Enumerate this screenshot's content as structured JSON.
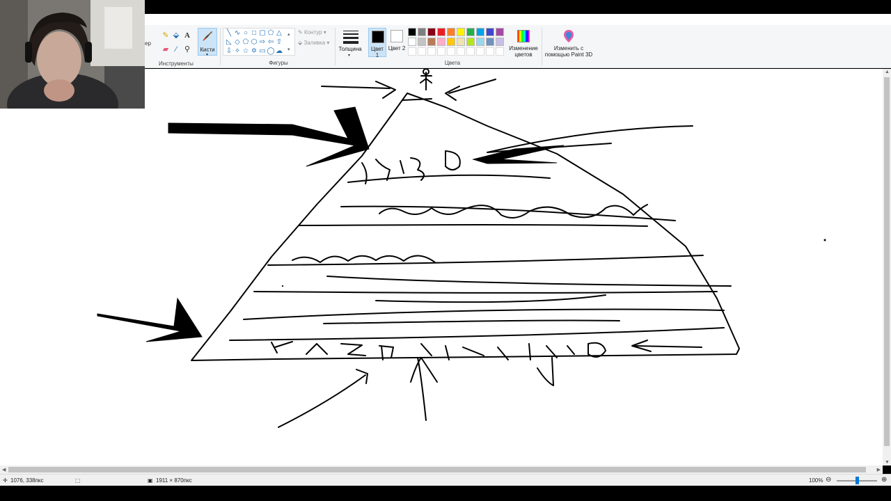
{
  "ribbon": {
    "clipped_label": "ер",
    "groups": {
      "tools": "Инструменты",
      "shapes": "Фигуры",
      "colors": "Цвета"
    },
    "brushes_label": "Кисти",
    "outline_label": "Контур",
    "fill_label": "Заливка",
    "thickness_label": "Толщина",
    "color1_label": "Цвет 1",
    "color2_label": "Цвет 2",
    "edit_colors_label": "Изменение цветов",
    "paint3d_label": "Изменить с помощью Paint 3D"
  },
  "palette": {
    "row1": [
      "#000000",
      "#7f7f7f",
      "#880015",
      "#ed1c24",
      "#ff7f27",
      "#fff200",
      "#22b14c",
      "#00a2e8",
      "#3f48cc",
      "#a349a4"
    ],
    "row2": [
      "#ffffff",
      "#c3c3c3",
      "#b97a57",
      "#ffaec9",
      "#ffc90e",
      "#efe4b0",
      "#b5e61d",
      "#99d9ea",
      "#7092be",
      "#c8bfe7"
    ],
    "color1": "#000000",
    "color2": "#ffffff"
  },
  "status": {
    "cursor_pos": "1076, 338пкс",
    "image_size": "1911 × 870пкс",
    "zoom": "100%"
  },
  "canvas_words": {
    "top": "музо",
    "second": "сельон",
    "third": "изелеги",
    "bottom": "казьтищиgко"
  }
}
